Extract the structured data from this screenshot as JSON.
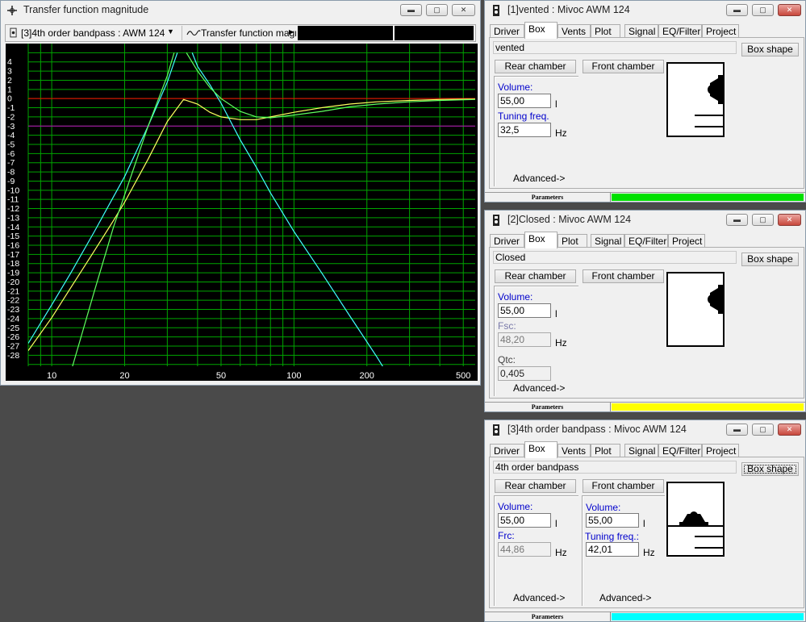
{
  "tf_window": {
    "title": "Transfer function magnitude",
    "selected_box": "[3]4th order bandpass : AWM 124",
    "plot_type": "Transfer function magn",
    "colors": {
      "bg": "#000000",
      "grid": "#00a500",
      "zero": "#ff0000",
      "ref3": "#c000c0"
    }
  },
  "chart_data": {
    "type": "line",
    "x_scale": "log",
    "xlim": [
      8,
      560
    ],
    "ylim": [
      -30,
      5
    ],
    "grid": true,
    "x_ticks": [
      10,
      20,
      50,
      100,
      200,
      500
    ],
    "x_tick_labels": [
      "10",
      "20",
      "50",
      "100",
      "200",
      "500"
    ],
    "y_ticks": [
      4,
      3,
      2,
      1,
      0,
      -1,
      -2,
      -3,
      -4,
      -5,
      -6,
      -7,
      -8,
      -9,
      -10,
      -11,
      -12,
      -13,
      -14,
      -15,
      -16,
      -17,
      -18,
      -19,
      -20,
      -21,
      -22,
      -23,
      -24,
      -25,
      -26,
      -27,
      -28
    ],
    "y_tick_labels": [
      "4",
      "3",
      "2",
      "1",
      "0",
      "-1",
      "-2",
      "-3",
      "-4",
      "-5",
      "-6",
      "-7",
      "-8",
      "-9",
      "-10",
      "-11",
      "-12",
      "-13",
      "-14",
      "-15",
      "-16",
      "-17",
      "-18",
      "-19",
      "-20",
      "-21",
      "-22",
      "-23",
      "-24",
      "-25",
      "-26",
      "-27",
      "-28"
    ],
    "reference_lines": [
      {
        "y": 0,
        "color": "#ff0000"
      },
      {
        "y": -3,
        "color": "#c000c0"
      }
    ],
    "series": [
      {
        "color": "#ffff60",
        "x": [
          8,
          10,
          12,
          15,
          18,
          20,
          25,
          30,
          35,
          40,
          45,
          50,
          60,
          70,
          80,
          100,
          130,
          170,
          220,
          300,
          400,
          560
        ],
        "y": [
          -27.5,
          -23.9,
          -20.6,
          -16.6,
          -13.3,
          -11.3,
          -6.6,
          -2.5,
          -0.1,
          -0.6,
          -1.5,
          -2.0,
          -2.3,
          -2.3,
          -2.0,
          -1.5,
          -1.0,
          -0.6,
          -0.35,
          -0.2,
          -0.1,
          -0.05
        ]
      },
      {
        "color": "#40ffff",
        "x": [
          8,
          10,
          12,
          15,
          18,
          20,
          25,
          30,
          33
        ],
        "y": [
          -26.7,
          -22.5,
          -19.0,
          -14.5,
          -10.7,
          -8.5,
          -3.0,
          1.8,
          5.0
        ]
      },
      {
        "color": "#40ffff",
        "x": [
          38,
          40,
          45,
          50,
          60,
          70,
          80,
          100,
          130,
          170,
          220,
          240
        ],
        "y": [
          5.0,
          3.5,
          1.5,
          -0.5,
          -4.5,
          -7.5,
          -10.3,
          -14.5,
          -19.0,
          -23.7,
          -28.2,
          -29.8
        ]
      },
      {
        "color": "#60ff60",
        "x": [
          12,
          15,
          18,
          20,
          25,
          30,
          32
        ],
        "y": [
          -29.8,
          -21.0,
          -14.0,
          -10.5,
          -3.0,
          2.5,
          5.0
        ]
      },
      {
        "color": "#60ff60",
        "x": [
          36,
          40,
          45,
          50,
          60,
          70,
          80,
          100,
          130,
          170,
          220,
          300,
          400,
          560
        ],
        "y": [
          5.0,
          3.0,
          1.2,
          0.0,
          -1.4,
          -2.0,
          -2.1,
          -1.8,
          -1.4,
          -0.9,
          -0.6,
          -0.35,
          -0.2,
          -0.1
        ]
      }
    ]
  },
  "panels": [
    {
      "title": "[1]vented : Mivoc AWM 124",
      "close_glyph": "✕",
      "tabs": [
        "Driver",
        "Box",
        "Vents",
        "Plot",
        "Signal",
        "EQ/Filter",
        "Project"
      ],
      "selected_tab": "Box",
      "box_name": "vented",
      "box_shape_label": "Box shape",
      "rear_label": "Rear chamber",
      "front_label": "Front chamber",
      "rear": {
        "label1": "Volume:",
        "value1": "55,00",
        "unit1": "l",
        "label2": "Tuning freq.",
        "value2": "32,5",
        "unit2": "Hz"
      },
      "advanced_label": "Advanced->",
      "status_label": "Parameters",
      "status_color": "#00e000"
    },
    {
      "title": "[2]Closed : Mivoc AWM 124",
      "close_glyph": "✕",
      "tabs": [
        "Driver",
        "Box",
        "Plot",
        "Signal",
        "EQ/Filter",
        "Project"
      ],
      "selected_tab": "Box",
      "box_name": "Closed",
      "box_shape_label": "Box shape",
      "rear_label": "Rear chamber",
      "front_label": "Front chamber",
      "rear": {
        "label1": "Volume:",
        "value1": "55,00",
        "unit1": "l",
        "label2": "Fsc:",
        "value2": "48,20",
        "unit2": "Hz",
        "label3": "Qtc:",
        "value3": "0,405"
      },
      "advanced_label": "Advanced->",
      "status_label": "Parameters",
      "status_color": "#ffff00"
    },
    {
      "title": "[3]4th order bandpass : Mivoc AWM 124",
      "close_glyph": "✕",
      "tabs": [
        "Driver",
        "Box",
        "Vents",
        "Plot",
        "Signal",
        "EQ/Filter",
        "Project"
      ],
      "selected_tab": "Box",
      "box_name": "4th order bandpass",
      "box_shape_label": "Box shape",
      "rear_label": "Rear chamber",
      "front_label": "Front chamber",
      "rear": {
        "label1": "Volume:",
        "value1": "55,00",
        "unit1": "l",
        "label2": "Frc:",
        "value2": "44,86",
        "unit2": "Hz"
      },
      "front": {
        "label1": "Volume:",
        "value1": "55,00",
        "unit1": "l",
        "label2": "Tuning freq.:",
        "value2": "42,01",
        "unit2": "Hz"
      },
      "advanced_label": "Advanced->",
      "advanced_label_front": "Advanced->",
      "status_label": "Parameters",
      "status_color": "#00ffff"
    }
  ]
}
